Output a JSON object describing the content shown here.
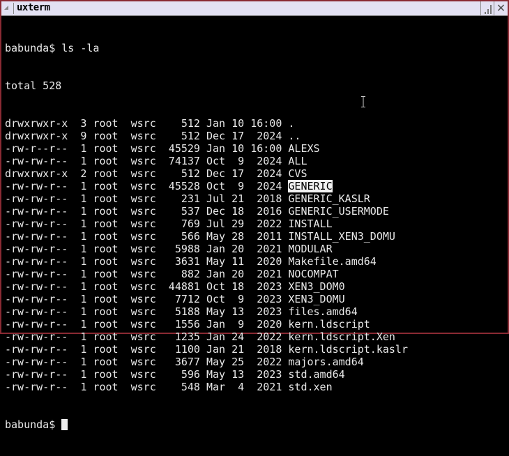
{
  "window": {
    "title": "uxterm"
  },
  "terminal": {
    "prompt": "babunda$ ",
    "command": "ls -la",
    "total": "total 528",
    "selected_name": "GENERIC",
    "entries": [
      {
        "meta": "drwxrwxr-x  3 root  wsrc    512 Jan 10 16:00 ",
        "name": "."
      },
      {
        "meta": "drwxrwxr-x  9 root  wsrc    512 Dec 17  2024 ",
        "name": ".."
      },
      {
        "meta": "-rw-r--r--  1 root  wsrc  45529 Jan 10 16:00 ",
        "name": "ALEXS"
      },
      {
        "meta": "-rw-rw-r--  1 root  wsrc  74137 Oct  9  2024 ",
        "name": "ALL"
      },
      {
        "meta": "drwxrwxr-x  2 root  wsrc    512 Dec 17  2024 ",
        "name": "CVS"
      },
      {
        "meta": "-rw-rw-r--  1 root  wsrc  45528 Oct  9  2024 ",
        "name": "GENERIC"
      },
      {
        "meta": "-rw-rw-r--  1 root  wsrc    231 Jul 21  2018 ",
        "name": "GENERIC_KASLR"
      },
      {
        "meta": "-rw-rw-r--  1 root  wsrc    537 Dec 18  2016 ",
        "name": "GENERIC_USERMODE"
      },
      {
        "meta": "-rw-rw-r--  1 root  wsrc    769 Jul 29  2022 ",
        "name": "INSTALL"
      },
      {
        "meta": "-rw-rw-r--  1 root  wsrc    566 May 28  2011 ",
        "name": "INSTALL_XEN3_DOMU"
      },
      {
        "meta": "-rw-rw-r--  1 root  wsrc   5988 Jan 20  2021 ",
        "name": "MODULAR"
      },
      {
        "meta": "-rw-rw-r--  1 root  wsrc   3631 May 11  2020 ",
        "name": "Makefile.amd64"
      },
      {
        "meta": "-rw-rw-r--  1 root  wsrc    882 Jan 20  2021 ",
        "name": "NOCOMPAT"
      },
      {
        "meta": "-rw-rw-r--  1 root  wsrc  44881 Oct 18  2023 ",
        "name": "XEN3_DOM0"
      },
      {
        "meta": "-rw-rw-r--  1 root  wsrc   7712 Oct  9  2023 ",
        "name": "XEN3_DOMU"
      },
      {
        "meta": "-rw-rw-r--  1 root  wsrc   5188 May 13  2023 ",
        "name": "files.amd64"
      },
      {
        "meta": "-rw-rw-r--  1 root  wsrc   1556 Jan  9  2020 ",
        "name": "kern.ldscript"
      },
      {
        "meta": "-rw-rw-r--  1 root  wsrc   1235 Jan 24  2022 ",
        "name": "kern.ldscript.Xen"
      },
      {
        "meta": "-rw-rw-r--  1 root  wsrc   1100 Jan 21  2018 ",
        "name": "kern.ldscript.kaslr"
      },
      {
        "meta": "-rw-rw-r--  1 root  wsrc   3677 May 25  2022 ",
        "name": "majors.amd64"
      },
      {
        "meta": "-rw-rw-r--  1 root  wsrc    596 May 13  2023 ",
        "name": "std.amd64"
      },
      {
        "meta": "-rw-rw-r--  1 root  wsrc    548 Mar  4  2021 ",
        "name": "std.xen"
      }
    ]
  }
}
